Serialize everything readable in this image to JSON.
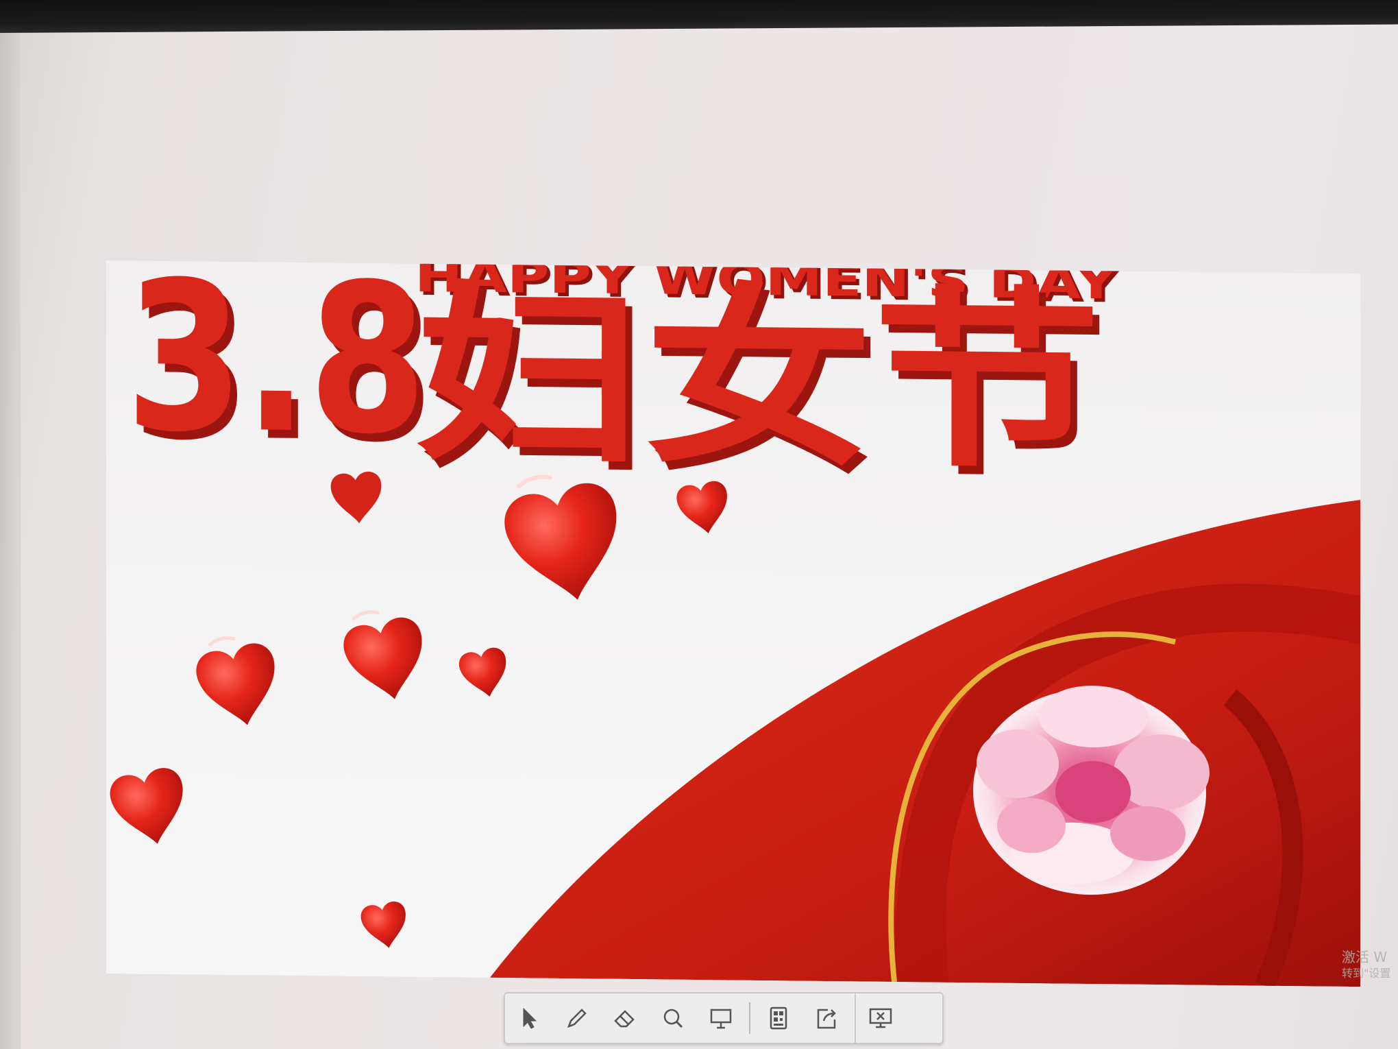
{
  "slide": {
    "number_title": "3.8",
    "chinese_title": "妇女节",
    "english_title": "HAPPY WOMEN'S DAY"
  },
  "toolbar": {
    "tools": [
      {
        "name": "pointer",
        "icon": "arrow-pointer-icon"
      },
      {
        "name": "pen",
        "icon": "pen-icon"
      },
      {
        "name": "eraser",
        "icon": "eraser-icon"
      },
      {
        "name": "magnifier",
        "icon": "magnifier-icon"
      },
      {
        "name": "screen",
        "icon": "screen-icon"
      },
      {
        "name": "qrcode",
        "icon": "qrcode-icon"
      },
      {
        "name": "share",
        "icon": "share-icon"
      },
      {
        "name": "exit",
        "icon": "exit-presentation-icon"
      }
    ]
  },
  "watermark": {
    "line1": "激活 W",
    "line2": "转到\"设置"
  },
  "colors": {
    "title_red": "#d9271c",
    "title_shadow": "#9c150f",
    "ribbon_red": "#c81d12",
    "ribbon_gold": "#e8b33a",
    "flower_pink": "#e98aa8"
  }
}
